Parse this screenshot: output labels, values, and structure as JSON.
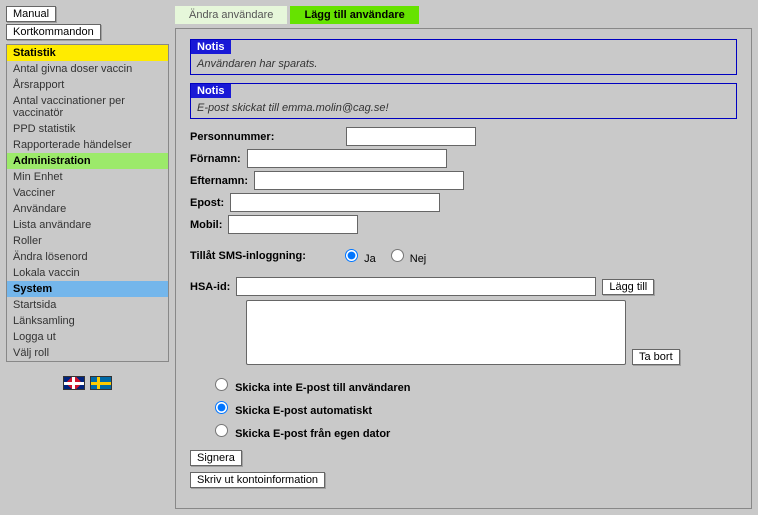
{
  "top_buttons": {
    "manual": "Manual",
    "shortcuts": "Kortkommandon"
  },
  "nav": {
    "stat_header": "Statistik",
    "stat_items": [
      "Antal givna doser vaccin",
      "Årsrapport",
      "Antal vaccinationer per vaccinatör",
      "PPD statistik",
      "Rapporterade händelser"
    ],
    "admin_header": "Administration",
    "admin_items": [
      "Min Enhet",
      "Vacciner",
      "Användare",
      "Lista användare",
      "Roller",
      "Ändra lösenord",
      "Lokala vaccin"
    ],
    "system_header": "System",
    "system_items": [
      "Startsida",
      "Länksamling",
      "Logga ut",
      "Välj roll"
    ]
  },
  "tabs": {
    "edit": "Ändra användare",
    "add": "Lägg till användare"
  },
  "notices": {
    "head": "Notis",
    "body1": "Användaren har sparats.",
    "body2": "E-post skickat till emma.molin@cag.se!"
  },
  "form": {
    "personnummer": "Personnummer:",
    "fornamn": "Förnamn:",
    "efternamn": "Efternamn:",
    "epost": "Epost:",
    "mobil": "Mobil:",
    "sms_label": "Tillåt SMS-inloggning:",
    "ja": "Ja",
    "nej": "Nej",
    "hsa_label": "HSA-id:",
    "add_btn": "Lägg till",
    "remove_btn": "Ta bort",
    "email_opt1": "Skicka inte E-post till användaren",
    "email_opt2": "Skicka E-post automatiskt",
    "email_opt3": "Skicka E-post från egen dator",
    "sign_btn": "Signera",
    "print_btn": "Skriv ut kontoinformation"
  }
}
